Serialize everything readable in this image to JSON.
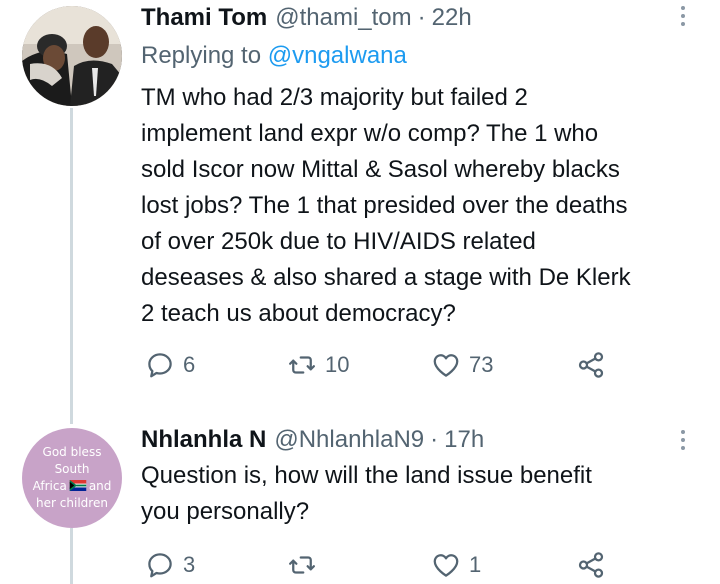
{
  "tweets": [
    {
      "author_name": "Thami Tom",
      "handle": "@thami_tom",
      "separator": "·",
      "time": "22h",
      "replying_prefix": "Replying to",
      "replying_to": "@vngalwana",
      "text": "TM who had 2/3 majority but failed 2 implement land expr w/o comp? The 1 who sold Iscor now Mittal & Sasol whereby blacks lost jobs? The 1 that presided over the deaths of over 250k due to HIV/AIDS related deseases & also shared a stage with De Klerk 2 teach us about democracy?",
      "lines": [
        "TM who had 2/3 majority but failed 2",
        "implement land expr w/o comp? The 1 who",
        "sold Iscor now Mittal & Sasol whereby blacks",
        "lost jobs? The 1 that presided over the deaths",
        "of over 250k due to HIV/AIDS related",
        "deseases & also shared a stage with De Klerk",
        "2 teach us about democracy?"
      ],
      "replies": "6",
      "retweets": "10",
      "likes": "73"
    },
    {
      "author_name": "Nhlanhla N",
      "handle": "@NhlanhlaN9",
      "separator": "·",
      "time": "17h",
      "avatar_text_1": "God bless South",
      "avatar_text_2a": "Africa",
      "avatar_text_2b": "and",
      "avatar_text_3": "her children",
      "text": "Question is, how will the land issue benefit you personally?",
      "lines": [
        "Question is, how will the land issue benefit",
        "you personally?"
      ],
      "replies": "3",
      "retweets": "",
      "likes": "1"
    }
  ],
  "icons": {
    "reply": "reply-icon",
    "retweet": "retweet-icon",
    "like": "heart-icon",
    "share": "share-icon",
    "more": "more-options-icon"
  },
  "colors": {
    "text": "#0f1419",
    "secondary": "#536471",
    "link": "#1d9bf0",
    "thread_line": "#cfd9de",
    "avatar2_bg": "#c8a3c8"
  }
}
